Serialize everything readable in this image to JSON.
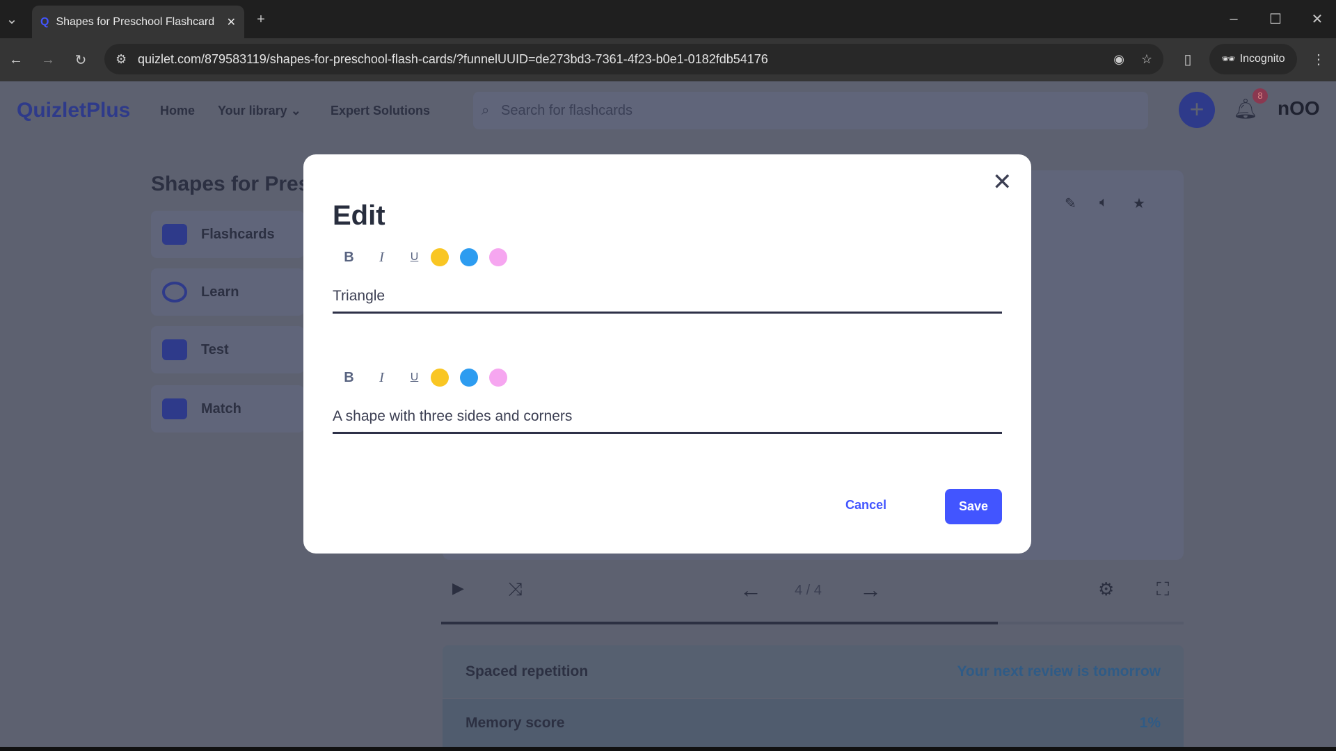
{
  "browser": {
    "tab_title": "Shapes for Preschool Flashcard",
    "url": "quizlet.com/879583119/shapes-for-preschool-flash-cards/?funnelUUID=de273bd3-7361-4f23-b0e1-0182fdb54176",
    "incognito_label": "Incognito"
  },
  "header": {
    "logo": "QuizletPlus",
    "nav": [
      "Home",
      "Your library",
      "Expert Solutions"
    ],
    "search_placeholder": "Search for flashcards",
    "notification_count": "8"
  },
  "set": {
    "title": "Shapes for Pres",
    "modes": [
      "Flashcards",
      "Learn",
      "Test",
      "Match"
    ],
    "counter": "4 / 4",
    "progress_percent": 75
  },
  "panels": {
    "spaced_label": "Spaced repetition",
    "spaced_value": "Your next review is tomorrow",
    "memory_label": "Memory score",
    "memory_value": "1%"
  },
  "modal": {
    "title": "Edit",
    "term": "Triangle",
    "definition": "A shape with three sides and corners",
    "cancel": "Cancel",
    "save": "Save",
    "format_bold": "B",
    "format_italic": "I",
    "format_underline": "U",
    "colors": [
      "#f9c623",
      "#2d9cf0",
      "#f6a6f0"
    ]
  }
}
